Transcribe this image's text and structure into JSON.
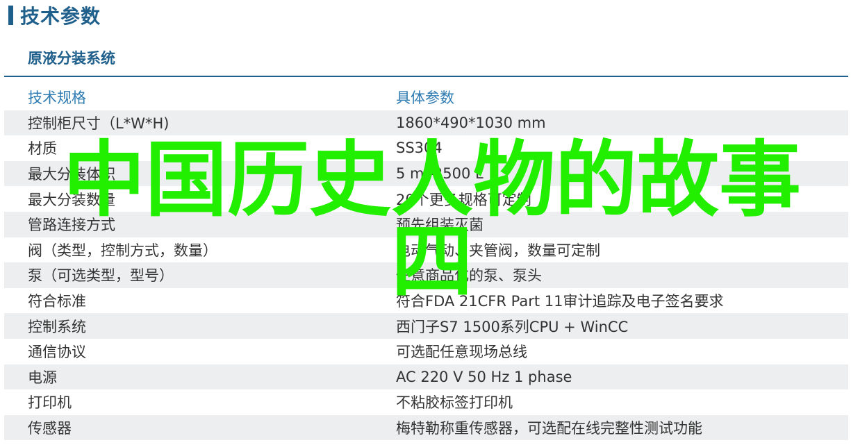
{
  "header": {
    "title": "技术参数"
  },
  "section": {
    "subtitle": "原液分装系统"
  },
  "table": {
    "columns": [
      "技术规格",
      "具体参数"
    ],
    "rows": [
      [
        "控制柜尺寸（L*W*H)",
        "1860*490*1030 mm"
      ],
      [
        "材质",
        "SS304"
      ],
      [
        "最大分装体积",
        "5 ml-2500 L"
      ],
      [
        "最大分装数量",
        "20个更多规格可定制"
      ],
      [
        "管路连接方式",
        "预先组装灭菌"
      ],
      [
        "阀（类型，控制方式，数量）",
        "电动气动、夹管阀，数量可定制"
      ],
      [
        "泵（可选类型，型号）",
        "任意商品化的泵、泵头"
      ],
      [
        "符合标准",
        "符合FDA 21CFR Part 11审计追踪及电子签名要求"
      ],
      [
        "控制系统",
        "西门子S7 1500系列CPU + WinCC"
      ],
      [
        "通信协议",
        "可选配任意现场总线"
      ],
      [
        "电源",
        "AC 220 V 50 Hz 1 phase"
      ],
      [
        "打印机",
        "不粘胶标签打印机"
      ],
      [
        "传感器",
        "梅特勒称重传感器，可选配在线完整性测试功能"
      ]
    ]
  },
  "watermark": {
    "line1": "中国历史人物的故事",
    "line2": "四",
    "color": "#22ee00"
  },
  "colors": {
    "accent": "#1f5f8b",
    "header_text": "#2e7bb2",
    "row_shade": "#eceeef"
  }
}
